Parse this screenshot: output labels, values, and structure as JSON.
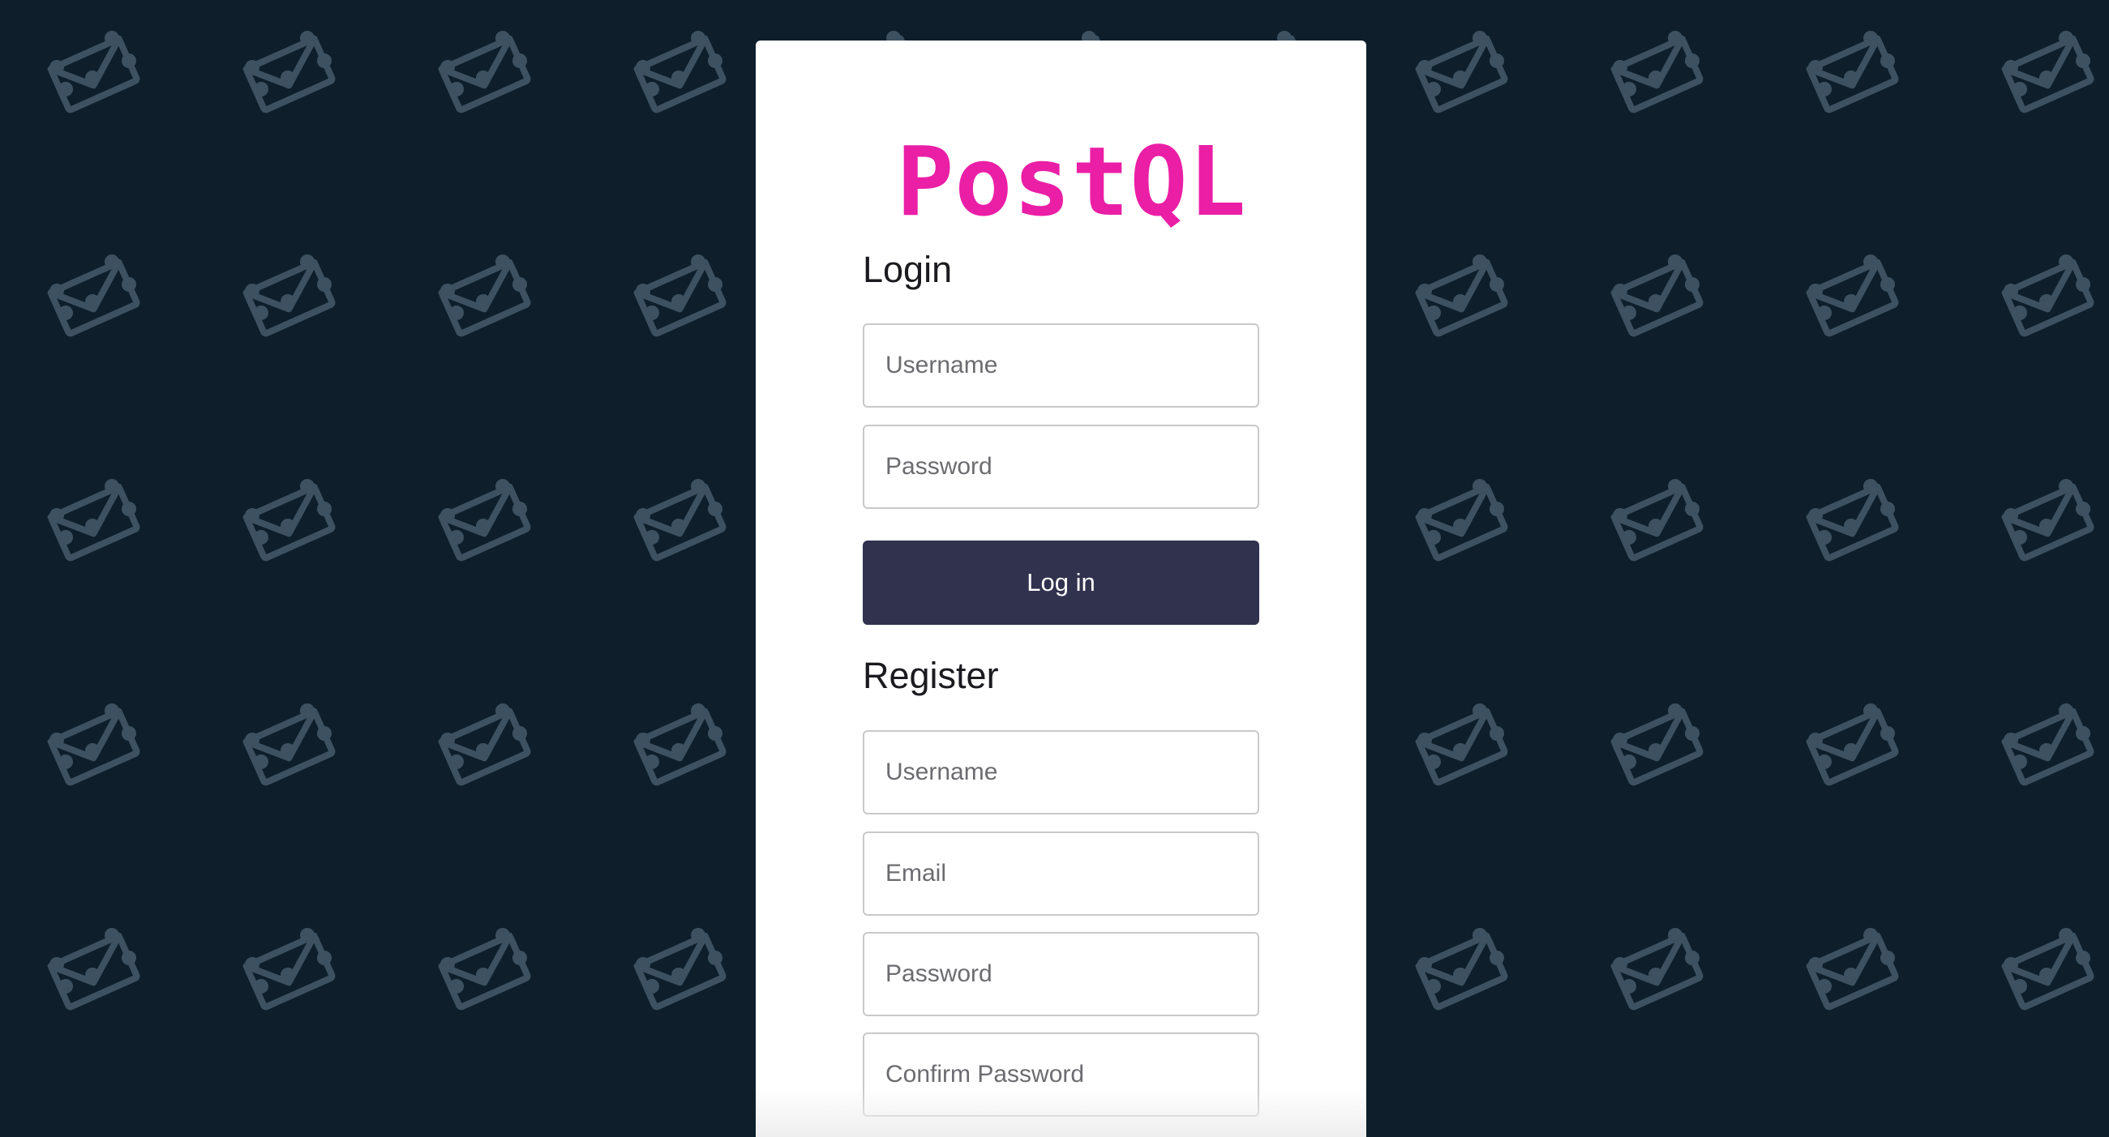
{
  "logo": {
    "text": "PostQL",
    "color": "#ea1fa6"
  },
  "background": {
    "color": "#0e1f2b",
    "pattern_icon": "envelope-network-icon",
    "pattern_color": "#3d5160"
  },
  "login": {
    "title": "Login",
    "username_placeholder": "Username",
    "password_placeholder": "Password",
    "button_label": "Log in",
    "button_color": "#30324e"
  },
  "register": {
    "title": "Register",
    "username_placeholder": "Username",
    "email_placeholder": "Email",
    "password_placeholder": "Password",
    "confirm_password_placeholder": "Confirm Password"
  }
}
